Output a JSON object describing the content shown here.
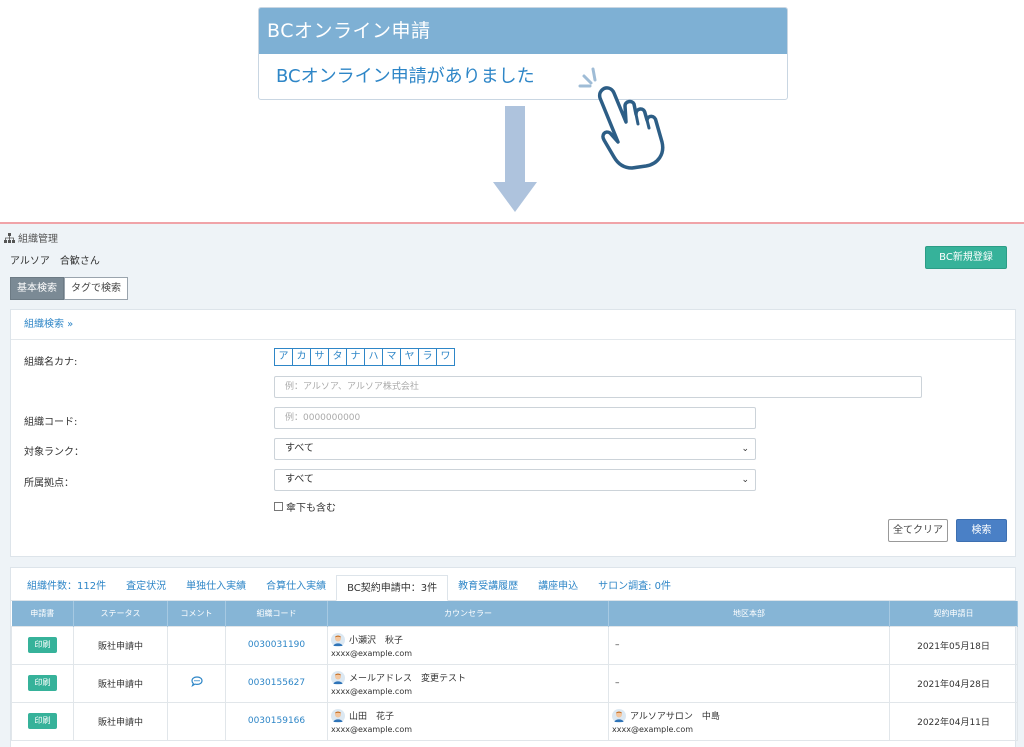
{
  "notification": {
    "title": "BCオンライン申請",
    "message": "BCオンライン申請がありました"
  },
  "header": {
    "section_label": "組織管理",
    "user_name": "アルソア　合歓さん",
    "new_button": "BC新規登録"
  },
  "search_mode_tabs": [
    {
      "label": "基本検索",
      "active": true
    },
    {
      "label": "タグで検索",
      "active": false
    }
  ],
  "search_form": {
    "toggle_label": "組織検索 »",
    "kana_label": "組織名カナ:",
    "kana_buttons": [
      "ア",
      "カ",
      "サ",
      "タ",
      "ナ",
      "ハ",
      "マ",
      "ヤ",
      "ラ",
      "ワ"
    ],
    "name_placeholder": "例：アルソア、アルソア株式会社",
    "code_label": "組織コード:",
    "code_placeholder": "例：0000000000",
    "rank_label": "対象ランク：",
    "rank_value": "すべて",
    "base_label": "所属拠点：",
    "base_value": "すべて",
    "include_sub_label": "傘下も含む",
    "clear_button": "全てクリア",
    "search_button": "検索"
  },
  "result_tabs": [
    {
      "label": "組織件数：112件",
      "active": false
    },
    {
      "label": "査定状況",
      "active": false
    },
    {
      "label": "単独仕入実績",
      "active": false
    },
    {
      "label": "合算仕入実績",
      "active": false
    },
    {
      "label": "BC契約申請中：3件",
      "active": true
    },
    {
      "label": "教育受講履歴",
      "active": false
    },
    {
      "label": "講座申込",
      "active": false
    },
    {
      "label": "サロン調査: 0件",
      "active": false
    }
  ],
  "table": {
    "columns": [
      "申請書",
      "ステータス",
      "コメント",
      "組織コード",
      "カウンセラー",
      "地区本部",
      "契約申請日"
    ],
    "rows": [
      {
        "print": "印刷",
        "status": "販社申請中",
        "comment": false,
        "code": "0030031190",
        "counselor": "小瀬沢　秋子",
        "counselor_email": "xxxx@example.com",
        "region": "–",
        "region_email": "",
        "date": "2021年05月18日"
      },
      {
        "print": "印刷",
        "status": "販社申請中",
        "comment": true,
        "code": "0030155627",
        "counselor": "メールアドレス　変更テスト",
        "counselor_email": "xxxx@example.com",
        "region": "–",
        "region_email": "",
        "date": "2021年04月28日"
      },
      {
        "print": "印刷",
        "status": "販社申請中",
        "comment": false,
        "code": "0030159166",
        "counselor": "山田　花子",
        "counselor_email": "xxxx@example.com",
        "region": "アルソアサロン　中島",
        "region_email": "xxxx@example.com",
        "date": "2022年04月11日"
      }
    ]
  },
  "colors": {
    "header_blue": "#7eb0d4",
    "link_blue": "#2e86c7",
    "accent_green": "#36b29a",
    "search_blue": "#4a80c6"
  }
}
